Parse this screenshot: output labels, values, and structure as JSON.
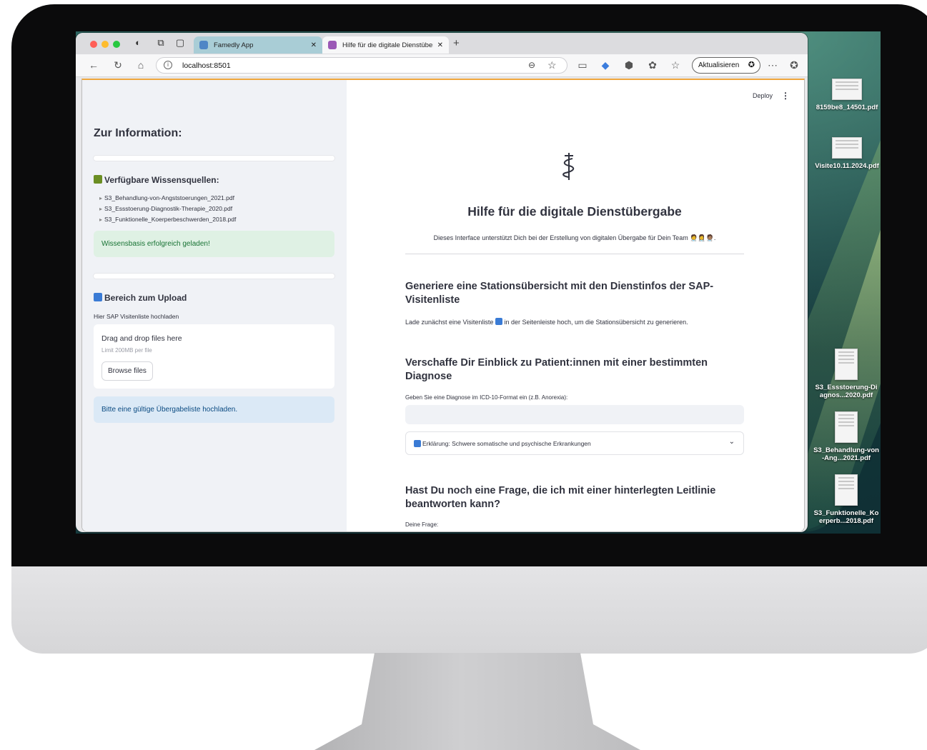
{
  "browser": {
    "tabs": [
      {
        "label": "Famedly App",
        "active": false,
        "favicon_color": "#4f86c6"
      },
      {
        "label": "Hilfe für die digitale Dienstüber",
        "active": true,
        "favicon_color": "#9b59b6"
      }
    ],
    "url": "localhost:8501",
    "update_button": "Aktualisieren"
  },
  "sidebar": {
    "heading": "Zur Information:",
    "sources_heading": "Verfügbare Wissensquellen:",
    "sources": [
      "S3_Behandlung-von-Angststoerungen_2021.pdf",
      "S3_Essstoerung-Diagnostik-Therapie_2020.pdf",
      "S3_Funktionelle_Koerperbeschwerden_2018.pdf"
    ],
    "success_msg": "Wissensbasis erfolgreich geladen!",
    "upload_heading": "Bereich zum Upload",
    "upload_caption": "Hier SAP Visitenliste hochladen",
    "dropzone_title": "Drag and drop files here",
    "dropzone_limit": "Limit 200MB per file",
    "browse_button": "Browse files",
    "info_msg": "Bitte eine gültige Übergabeliste hochladen."
  },
  "main": {
    "deploy": "Deploy",
    "title": "Hilfe für die digitale Dienstübergabe",
    "subtitle": "Dieses Interface unterstützt Dich bei der Erstellung von digitalen Übergabe für Dein Team 🧑‍⚕️👩‍⚕️🧑🏽‍⚕️.",
    "section1_title": "Generiere eine Stationsübersicht mit den Dienstinfos der SAP-Visitenliste",
    "section1_text_a": "Lade zunächst eine Visitenliste",
    "section1_text_b": "in der Seitenleiste hoch, um die Stationsübersicht zu generieren.",
    "section2_title": "Verschaffe Dir Einblick zu Patient:innen mit einer bestimmten Diagnose",
    "diagnosis_label": "Geben Sie eine Diagnose im ICD-10-Format ein (z.B. Anorexia):",
    "diagnosis_value": "",
    "expander_label": "Erklärung: Schwere somatische und psychische Erkrankungen",
    "section3_title": "Hast Du noch eine Frage, die ich mit einer hinterlegten Leitlinie beantworten kann?",
    "question_label": "Deine Frage:"
  },
  "desktop": {
    "files": [
      "8159be8_14501.pdf",
      "Visite10.11.2024.pdf",
      "S3_Essstoerung-Diagnos...2020.pdf",
      "S3_Behandlung-von-Ang...2021.pdf",
      "S3_Funktionelle_Koerperb...2018.pdf"
    ]
  }
}
